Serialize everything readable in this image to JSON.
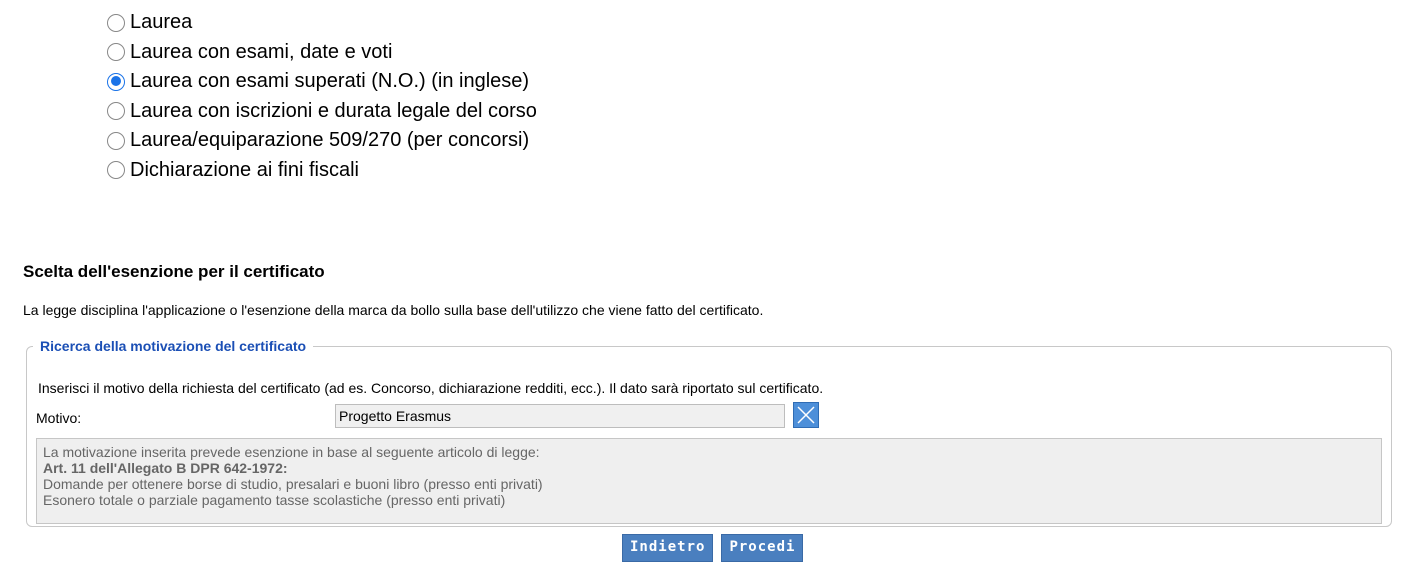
{
  "options": [
    {
      "label": "Laurea",
      "checked": false
    },
    {
      "label": "Laurea con esami, date e voti",
      "checked": false
    },
    {
      "label": "Laurea con esami superati (N.O.) (in inglese)",
      "checked": true
    },
    {
      "label": "Laurea con iscrizioni e durata legale del corso",
      "checked": false
    },
    {
      "label": "Laurea/equiparazione 509/270 (per concorsi)",
      "checked": false
    },
    {
      "label": "Dichiarazione ai fini fiscali",
      "checked": false
    }
  ],
  "exemption": {
    "title": "Scelta dell'esenzione per il certificato",
    "description": "La legge disciplina l'applicazione o l'esenzione della marca da bollo sulla base dell'utilizzo che viene fatto del certificato."
  },
  "search": {
    "legend": "Ricerca della motivazione del certificato",
    "instructions": "Inserisci il motivo della richiesta del certificato (ad es. Concorso, dichiarazione redditi, ecc.). Il dato sarà riportato sul certificato.",
    "motivo_label": "Motivo:",
    "motivo_value": "Progetto Erasmus",
    "clear_icon": "close-x-icon"
  },
  "info": {
    "line1": "La motivazione inserita prevede esenzione in base al seguente articolo di legge:",
    "article": "Art. 11 dell'Allegato B DPR 642-1972:",
    "line3": "Domande per ottenere borse di studio, presalari e buoni libro (presso enti privati)",
    "line4": "Esonero totale o parziale pagamento tasse scolastiche (presso enti privati)"
  },
  "buttons": {
    "back": "Indietro",
    "proceed": "Procedi"
  },
  "colors": {
    "accent": "#1a73e8",
    "legend": "#1b4fb5",
    "button": "#4a7fbf"
  }
}
